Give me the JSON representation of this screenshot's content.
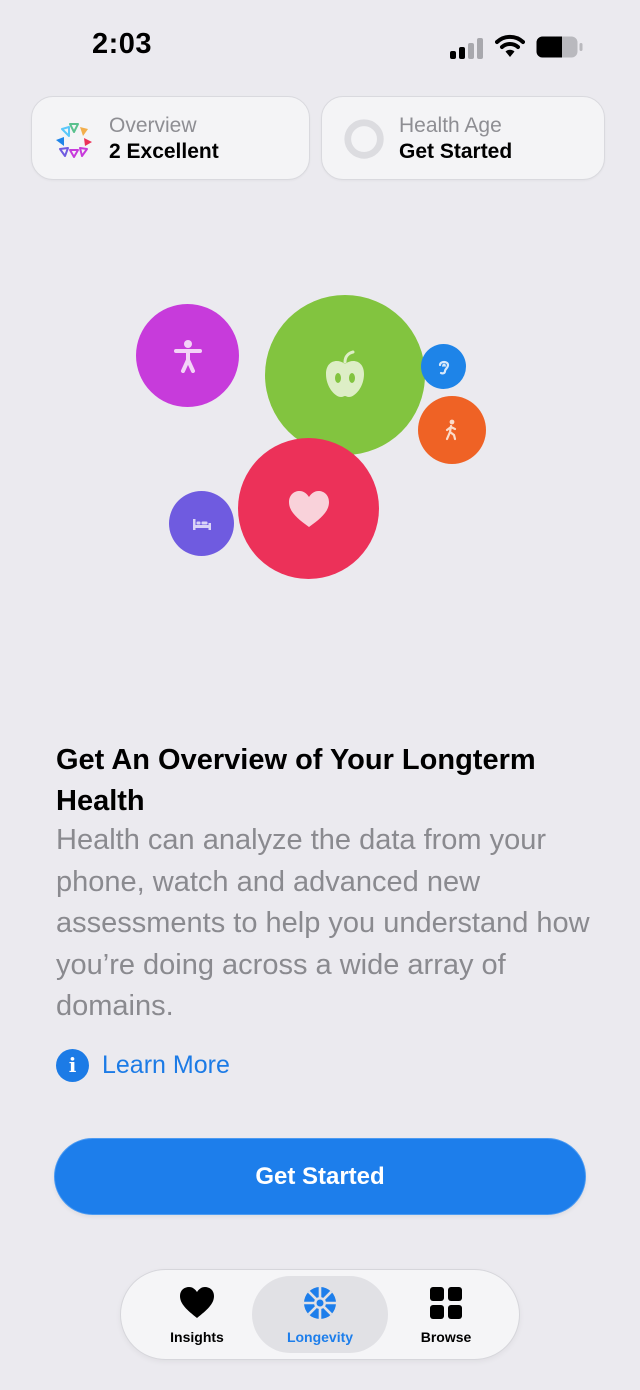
{
  "status_bar": {
    "time": "2:03",
    "icons": [
      "cellular-signal-icon",
      "wifi-icon",
      "battery-icon"
    ]
  },
  "top_cards": {
    "overview": {
      "label": "Overview",
      "value": "2 Excellent",
      "icon": "overview-petals-icon"
    },
    "health_age": {
      "label": "Health Age",
      "value": "Get Started",
      "icon": "ring-icon"
    }
  },
  "bubbles": [
    {
      "name": "mobility",
      "icon": "figure-icon",
      "color": "#C73BDB"
    },
    {
      "name": "nutrition",
      "icon": "apple-icon",
      "color": "#82C43F"
    },
    {
      "name": "hearing",
      "icon": "ear-icon",
      "color": "#1E84E8"
    },
    {
      "name": "activity",
      "icon": "walking-figure-icon",
      "color": "#EF6225"
    },
    {
      "name": "heart",
      "icon": "heart-icon",
      "color": "#EC3159"
    },
    {
      "name": "sleep",
      "icon": "bed-icon",
      "color": "#6F5BE0"
    }
  ],
  "content": {
    "headline": "Get An Overview of Your Longterm Health",
    "body": "Health can analyze the data from your phone, watch and advanced new assessments to help you understand how you’re doing across a wide array of domains.",
    "learn_more": "Learn More"
  },
  "cta": {
    "label": "Get Started"
  },
  "tab_bar": {
    "tabs": [
      {
        "label": "Insights",
        "icon": "heart-icon",
        "selected": false
      },
      {
        "label": "Longevity",
        "icon": "longevity-wheel-icon",
        "selected": true
      },
      {
        "label": "Browse",
        "icon": "grid-icon",
        "selected": false
      }
    ]
  },
  "colors": {
    "accent": "#1D7EEB",
    "background": "#EBEAEF"
  }
}
